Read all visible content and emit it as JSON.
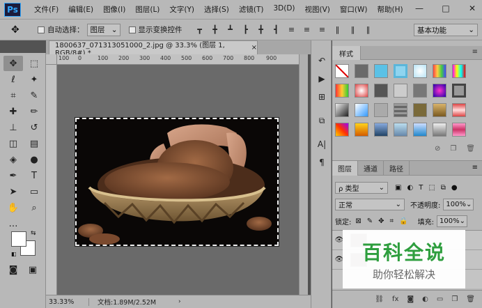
{
  "app": {
    "logo": "Ps"
  },
  "menu": [
    "文件(F)",
    "编辑(E)",
    "图像(I)",
    "图层(L)",
    "文字(Y)",
    "选择(S)",
    "滤镜(T)",
    "3D(D)",
    "视图(V)",
    "窗口(W)",
    "帮助(H)"
  ],
  "window_controls": {
    "minimize": "—",
    "maximize": "□",
    "close": "✕"
  },
  "options": {
    "auto_select_label": "自动选择：",
    "auto_select_value": "图层",
    "show_transform_label": "显示变换控件",
    "workspace": "基本功能"
  },
  "document": {
    "tab_title": "1800637_071313051000_2.jpg @ 33.3% (图层 1, RGB/8#) *",
    "close": "×",
    "ruler_ticks": [
      "100",
      "0",
      "100",
      "200",
      "300",
      "400",
      "500",
      "600",
      "700",
      "800",
      "900",
      "1000"
    ]
  },
  "status": {
    "zoom": "33.33%",
    "doc_info": "文档:1.89M/2.52M",
    "arrow": "›"
  },
  "styles_panel": {
    "tab": "样式",
    "menu": "≡"
  },
  "layers_panel": {
    "tabs": [
      "图层",
      "通道",
      "路径"
    ],
    "menu": "≡",
    "filter_kind": "ρ 类型",
    "blend_mode": "正常",
    "opacity_label": "不透明度:",
    "opacity_value": "100%",
    "lock_label": "锁定:",
    "fill_label": "填充:",
    "fill_value": "100%"
  },
  "watermark": {
    "title": "百科全说",
    "subtitle": "助你轻松解决"
  }
}
